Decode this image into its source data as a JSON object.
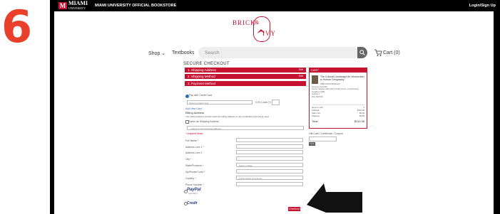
{
  "step_number": "6",
  "header": {
    "logo_top": "MIAMI",
    "logo_bottom": "UNIVERSITY",
    "store_name": "MIAMI UNIVERSITY OFFICIAL BOOKSTORE",
    "login": "Login/Sign Up"
  },
  "brand": {
    "line1": "BRICK",
    "amp": "&",
    "line2": "IVY"
  },
  "nav": {
    "shop": "Shop",
    "textbooks": "Textbooks",
    "search_placeholder": "Search",
    "cart": "Cart (0)"
  },
  "checkout": {
    "title": "SECURE CHECKOUT",
    "sections": [
      {
        "label": "1. Shipping Address",
        "action": "Edit"
      },
      {
        "label": "2. Shipping Method",
        "action": "Edit"
      },
      {
        "label": "3. Payment Method",
        "action": ""
      }
    ],
    "pay_credit": "Pay with Credit Card",
    "credit_select": "Select a Credit Card",
    "cvv": "CVV Code (?)",
    "add_new": "Add New Card",
    "billing_title": "Billing Address",
    "billing_note": "Your billing address should match the billing address on the credit/debit card being used.",
    "same_as": "Same as Shipping Address",
    "prev_addr": "-- Select to Use Previous Address --",
    "required": "* required fields",
    "fields": [
      {
        "label": "Full Name *",
        "value": ""
      },
      {
        "label": "Address Line 1 *",
        "value": ""
      },
      {
        "label": "Address Line 2",
        "value": ""
      },
      {
        "label": "City *",
        "value": ""
      },
      {
        "label": "State/Province *",
        "value": "-Select a State-"
      },
      {
        "label": "Zip/Postal Code *",
        "value": ""
      },
      {
        "label": "Country *",
        "value": "United States of America"
      },
      {
        "label": "Phone Number *",
        "value": ""
      }
    ],
    "paypal": "PayPal",
    "paypal_sub": "Learn More",
    "paypal_credit": "Credit",
    "checkout_button": "Checkout"
  },
  "cart_panel": {
    "header": "CART",
    "item_title": "The Cultural Landscape An Introduction to Human Geography",
    "item_isbn": "ISBN 9780134206233",
    "meta": [
      {
        "k": "Semester",
        "v": "Fall 2020"
      },
      {
        "k": "Course",
        "v": "Hamilton-GEO 159 F Global Forces, Local Diversity"
      },
      {
        "k": "Condition",
        "v": "USED"
      },
      {
        "k": "Quantity",
        "v": "1"
      },
      {
        "k": "Price",
        "v": "$104.98"
      }
    ],
    "items_in_cart": "Items in Cart",
    "items_count": "1",
    "subtotal_label": "Subtotal",
    "subtotal": "$104.98",
    "tax_label": "Sales Tax",
    "tax": "$0.00",
    "ship_label": "Shipping",
    "ship": "$9.60",
    "total_label": "Total",
    "total": "$114.58"
  },
  "gift": {
    "label": "Gift Card / Certificate / Coupon",
    "apply": "Apply"
  },
  "colors": {
    "accent": "#c41230",
    "step": "#e8402a"
  }
}
